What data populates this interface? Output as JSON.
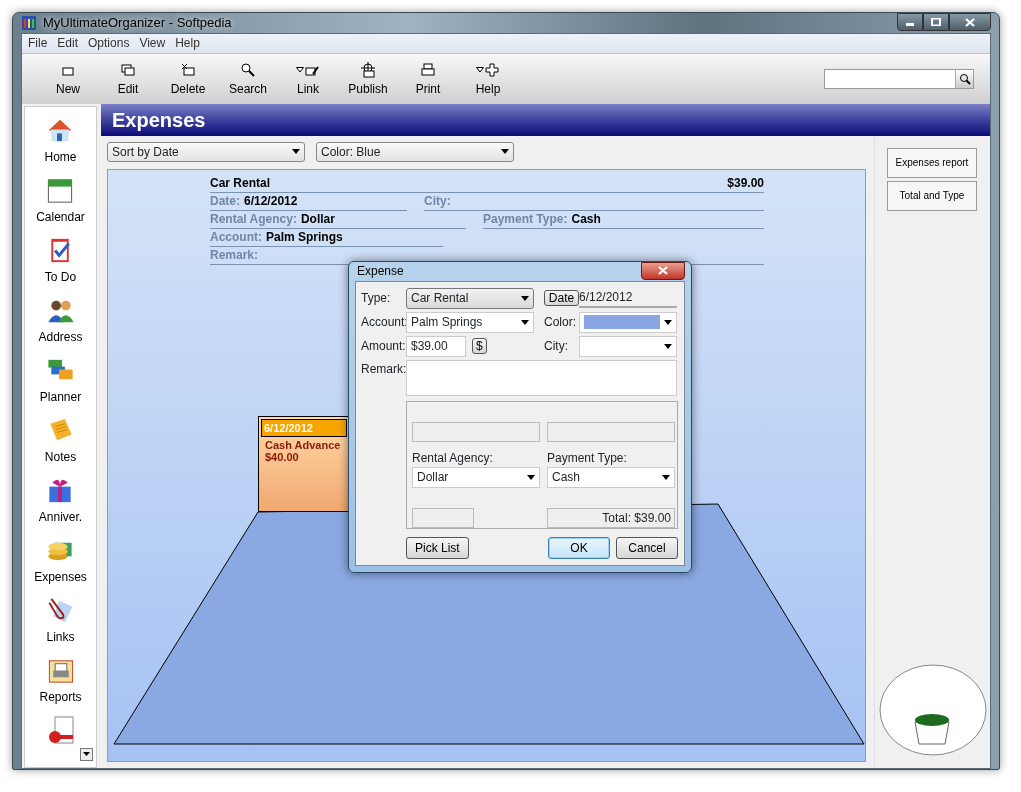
{
  "window": {
    "title": "MyUltimateOrganizer - Softpedia"
  },
  "menu": [
    "File",
    "Edit",
    "Options",
    "View",
    "Help"
  ],
  "toolbar": [
    {
      "label": "New",
      "dropdown": false
    },
    {
      "label": "Edit",
      "dropdown": false
    },
    {
      "label": "Delete",
      "dropdown": false
    },
    {
      "label": "Search",
      "dropdown": false
    },
    {
      "label": "Link",
      "dropdown": true
    },
    {
      "label": "Publish",
      "dropdown": false
    },
    {
      "label": "Print",
      "dropdown": false
    },
    {
      "label": "Help",
      "dropdown": true
    }
  ],
  "sidebar": {
    "items": [
      {
        "label": "Home"
      },
      {
        "label": "Calendar"
      },
      {
        "label": "To Do"
      },
      {
        "label": "Address"
      },
      {
        "label": "Planner"
      },
      {
        "label": "Notes"
      },
      {
        "label": "Anniver."
      },
      {
        "label": "Expenses"
      },
      {
        "label": "Links"
      },
      {
        "label": "Reports"
      }
    ]
  },
  "header": {
    "title": "Expenses"
  },
  "filters": [
    "Sort by Date",
    "Color: Blue"
  ],
  "record": {
    "title": "Car Rental",
    "amount": "$39.00",
    "rows": [
      [
        {
          "label": "Date:",
          "value": "6/12/2012"
        },
        {
          "label": "City:"
        }
      ],
      [
        {
          "label": "Rental Agency:",
          "value": "Dollar"
        },
        {
          "label": "Payment Type:",
          "value": "Cash"
        }
      ],
      [
        {
          "label": "Account:",
          "value": "Palm Springs"
        }
      ],
      [
        {
          "label": "Remark:"
        }
      ]
    ]
  },
  "note": {
    "date": "6/12/2012",
    "title": "Cash Advance",
    "amount": "$40.00"
  },
  "right_panel": {
    "buttons": [
      "Expenses report",
      "Total and Type"
    ]
  },
  "dialog": {
    "title": "Expense",
    "type_label": "Type:",
    "type": "Car Rental",
    "date_button": "Date",
    "date": "6/12/2012",
    "account_label": "Account:",
    "account": "Palm Springs",
    "color_label": "Color:",
    "color": "#8aa6e3",
    "amount_label": "Amount:",
    "amount": "$39.00",
    "currency_button": "$",
    "city_label": "City:",
    "remark_label": "Remark:",
    "agency_label": "Rental Agency:",
    "agency": "Dollar",
    "payment_label": "Payment Type:",
    "payment": "Cash",
    "total": "Total: $39.00",
    "buttons": [
      {
        "label": "Pick List",
        "default": false
      },
      {
        "label": "OK",
        "default": true
      },
      {
        "label": "Cancel",
        "default": false
      }
    ]
  }
}
